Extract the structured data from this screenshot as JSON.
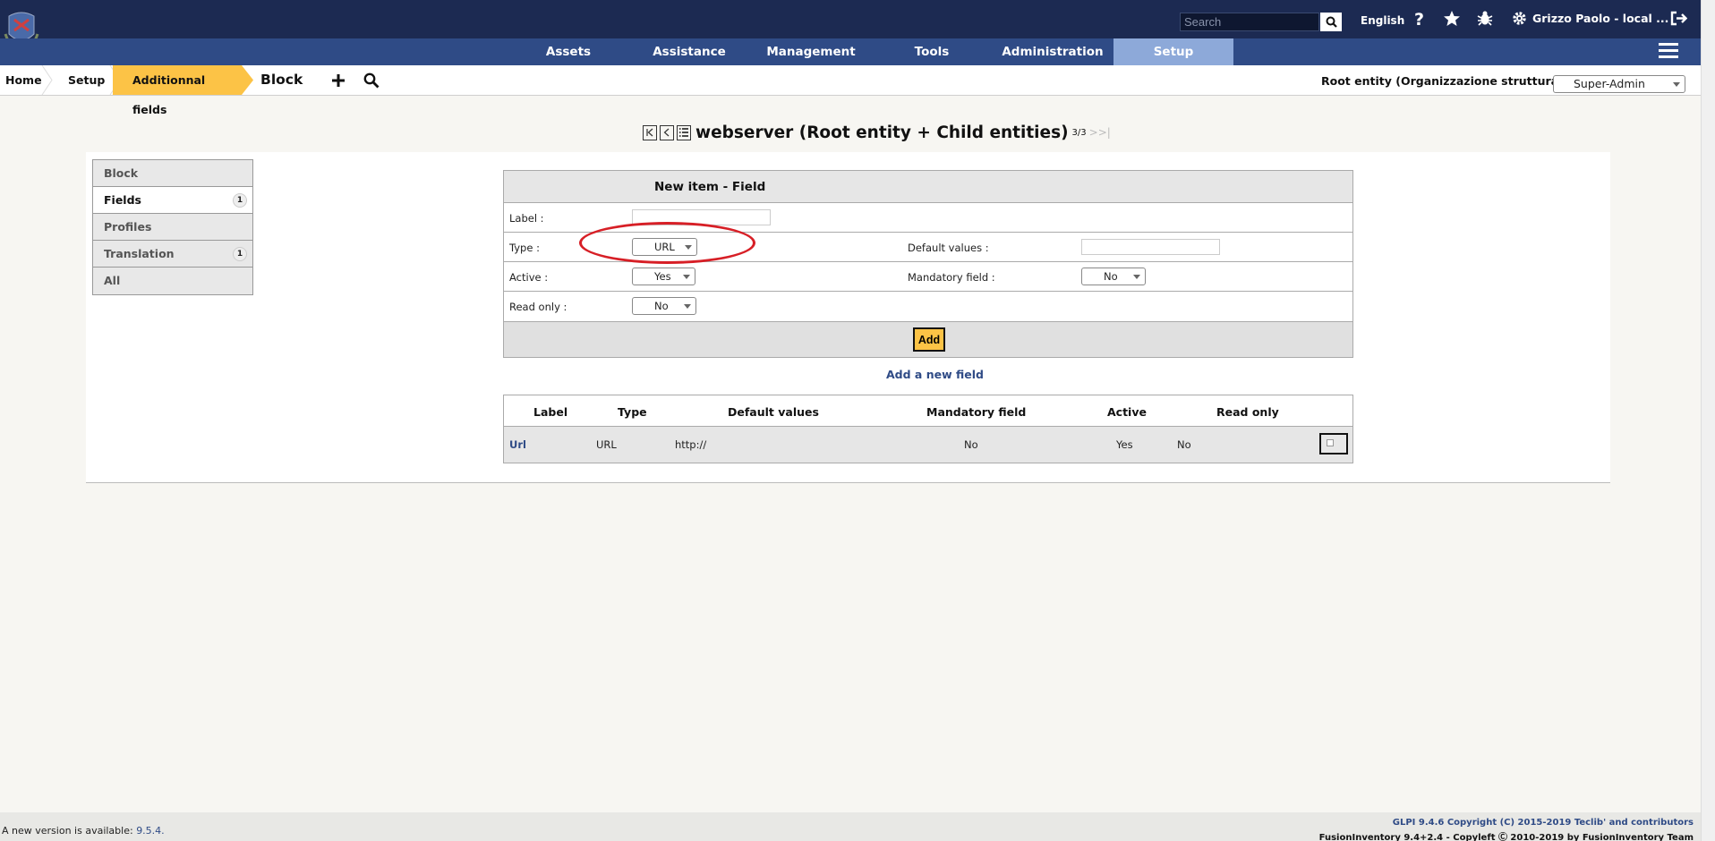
{
  "header": {
    "search_placeholder": "Search",
    "language": "English",
    "user": "Grizzo Paolo - local ..."
  },
  "menu": {
    "items": [
      "Assets",
      "Assistance",
      "Management",
      "Tools",
      "Administration",
      "Setup"
    ],
    "active": "Setup"
  },
  "breadcrumb": {
    "items": [
      "Home",
      "Setup",
      "Additionnal fields"
    ],
    "current": "Block",
    "entity": "Root entity (Organizzazione struttura)",
    "profile": "Super-Admin"
  },
  "title": {
    "text": "webserver (Root entity + Child entities)",
    "count": "3/3"
  },
  "tabs": [
    {
      "label": "Block",
      "badge": ""
    },
    {
      "label": "Fields",
      "badge": "1"
    },
    {
      "label": "Profiles",
      "badge": ""
    },
    {
      "label": "Translation",
      "badge": "1"
    },
    {
      "label": "All",
      "badge": ""
    }
  ],
  "form": {
    "header": "New item - Field",
    "label_label": "Label :",
    "type_label": "Type :",
    "type_value": "URL",
    "default_label": "Default values :",
    "active_label": "Active :",
    "active_value": "Yes",
    "mandatory_label": "Mandatory field :",
    "mandatory_value": "No",
    "readonly_label": "Read only :",
    "readonly_value": "No",
    "add_button": "Add"
  },
  "add_link": "Add a new field",
  "list": {
    "headers": [
      "Label",
      "Type",
      "Default values",
      "Mandatory field",
      "Active",
      "Read only"
    ],
    "rows": [
      {
        "label": "Url",
        "type": "URL",
        "default": "http://",
        "mandatory": "No",
        "active": "Yes",
        "readonly": "No"
      }
    ]
  },
  "footer": {
    "new_version_text": "A new version is available: ",
    "new_version": "9.5.4.",
    "copyright1": "GLPI 9.4.6 Copyright (C) 2015-2019 Teclib' and contributors",
    "copyright2": "FusionInventory 9.4+2.4 - Copyleft Ⓒ 2010-2019 by FusionInventory Team"
  },
  "colors": {
    "topbar": "#1c2a52",
    "menubar": "#2f4b86",
    "menu_active": "#8da9d9",
    "accent": "#fcc346",
    "annotation": "#d71f26"
  }
}
